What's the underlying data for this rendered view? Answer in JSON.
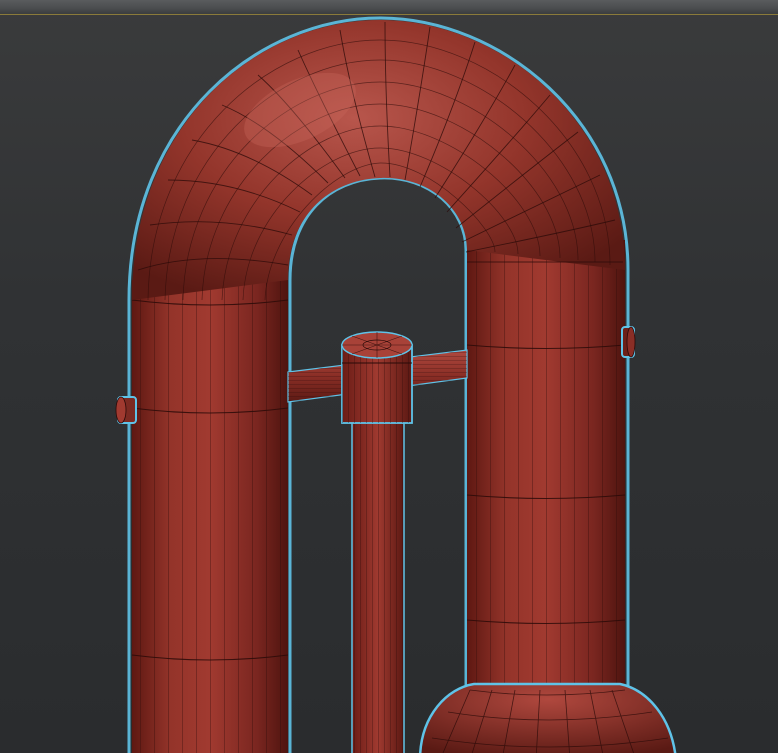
{
  "viewport": {
    "background_color": "#2f3133",
    "selection_outline_color": "#5fc3e8",
    "mesh_color": "#8a2a22",
    "mesh_highlight_color": "#b8544a",
    "wireframe_color": "#2a0a08"
  },
  "scene": {
    "object": "tuba-pipe-bend",
    "selected": true
  }
}
